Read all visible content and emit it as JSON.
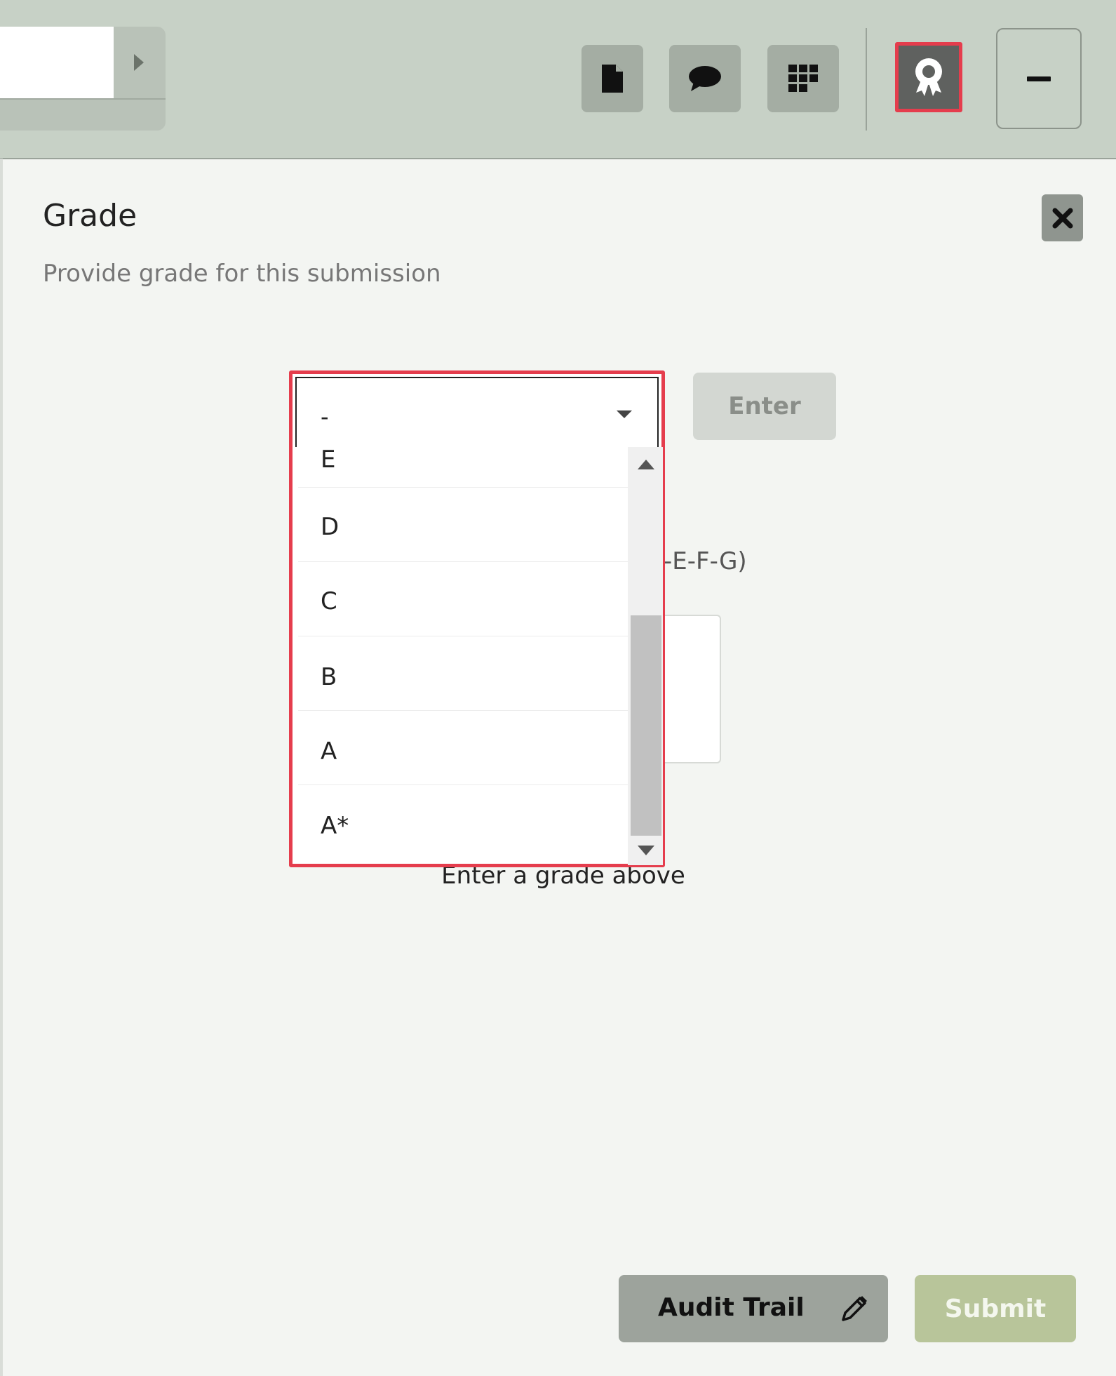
{
  "toolbar": {
    "icons": [
      "document-icon",
      "comment-icon",
      "grid-icon",
      "award-icon",
      "minimize-icon"
    ]
  },
  "panel": {
    "title": "Grade",
    "subtitle": "Provide grade for this submission",
    "partial_scale_text": "-E-F-G)",
    "hint": "Enter a grade above"
  },
  "grade_select": {
    "selected": "-",
    "options": [
      "E",
      "D",
      "C",
      "B",
      "A",
      "A*"
    ]
  },
  "buttons": {
    "enter": "Enter",
    "audit_trail": "Audit Trail",
    "submit": "Submit"
  },
  "colors": {
    "highlight": "#e53d4d",
    "toolbar_bg": "#c7d1c6",
    "submit_bg": "#b8c59a"
  }
}
